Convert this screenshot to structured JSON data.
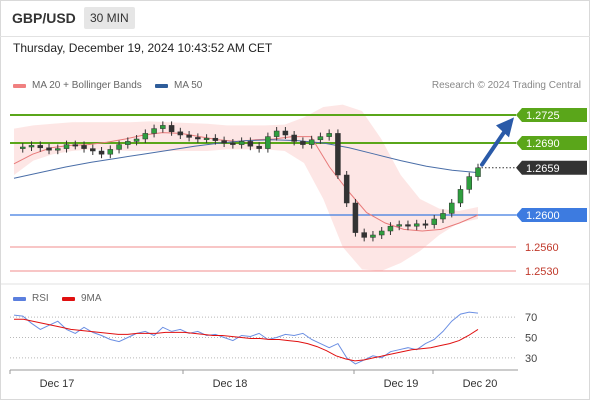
{
  "header": {
    "symbol": "GBP/USD",
    "timeframe": "30 MIN"
  },
  "timestamp": "Thursday, December 19, 2024 10:43:52 AM CET",
  "legend": {
    "main": [
      {
        "label": "MA 20 + Bollinger Bands",
        "color": "#f08080"
      },
      {
        "label": "MA 50",
        "color": "#2f5d9a"
      }
    ],
    "indicator": [
      {
        "label": "RSI",
        "color": "#5b7fde"
      },
      {
        "label": "9MA",
        "color": "#e01010"
      }
    ]
  },
  "credit": "Research © 2024 Trading Central",
  "chart_data": [
    {
      "type": "candlestick",
      "ylim": [
        1.2515,
        1.275
      ],
      "x_labels": [
        "Dec 17",
        "Dec 18",
        "Dec 19",
        "Dec 20"
      ],
      "levels": [
        {
          "value": 1.2725,
          "label": "1.2725",
          "kind": "resistance",
          "color": "#5aa61a"
        },
        {
          "value": 1.269,
          "label": "1.2690",
          "kind": "resistance",
          "color": "#5aa61a"
        },
        {
          "value": 1.2659,
          "label": "1.2659",
          "kind": "current",
          "color": "#333333"
        },
        {
          "value": 1.26,
          "label": "1.2600",
          "kind": "support",
          "color": "#3d7be0"
        },
        {
          "value": 1.256,
          "label": "1.2560",
          "kind": "support",
          "color": "#f28e8e"
        },
        {
          "value": 1.253,
          "label": "1.2530",
          "kind": "support",
          "color": "#f28e8e"
        }
      ],
      "close_path": [
        1.2683,
        1.2685,
        1.2687,
        1.2684,
        1.2681,
        1.2683,
        1.2688,
        1.2687,
        1.2683,
        1.268,
        1.2676,
        1.2682,
        1.2688,
        1.2692,
        1.2695,
        1.2702,
        1.2708,
        1.2712,
        1.2704,
        1.27,
        1.2697,
        1.2695,
        1.2696,
        1.2693,
        1.269,
        1.2688,
        1.2692,
        1.2686,
        1.2683,
        1.2698,
        1.2705,
        1.27,
        1.2692,
        1.2688,
        1.2694,
        1.2698,
        1.2702,
        1.265,
        1.2615,
        1.2578,
        1.2572,
        1.2575,
        1.258,
        1.2586,
        1.2588,
        1.2586,
        1.2589,
        1.2588,
        1.2595,
        1.2602,
        1.2615,
        1.2632,
        1.2648,
        1.2659
      ],
      "forecast": {
        "from": 1.2663,
        "to": 1.2722
      },
      "ma50": [
        1.2646,
        1.2653,
        1.266,
        1.2666,
        1.2671,
        1.2676,
        1.2681,
        1.2686,
        1.269,
        1.2693,
        1.2694,
        1.2693,
        1.269,
        1.2684,
        1.2676,
        1.2668,
        1.2661,
        1.2656,
        1.2653
      ],
      "ma20": [
        1.2664,
        1.2676,
        1.2684,
        1.2687,
        1.2688,
        1.2691,
        1.2695,
        1.27,
        1.2703,
        1.2702,
        1.2698,
        1.2694,
        1.2692,
        1.2694,
        1.2695,
        1.2698,
        1.2698,
        1.266,
        1.263,
        1.2603,
        1.259,
        1.2582,
        1.258,
        1.2582,
        1.259,
        1.26
      ]
    },
    {
      "type": "line",
      "ylim": [
        20,
        80
      ],
      "ticks": [
        70,
        50,
        30
      ],
      "series": [
        {
          "name": "RSI",
          "values": [
            72,
            71,
            64,
            58,
            62,
            66,
            58,
            54,
            60,
            55,
            52,
            48,
            46,
            50,
            54,
            56,
            52,
            60,
            56,
            58,
            54,
            56,
            52,
            53,
            50,
            47,
            52,
            51,
            54,
            48,
            50,
            53,
            52,
            54,
            48,
            44,
            40,
            44,
            30,
            24,
            28,
            32,
            30,
            36,
            38,
            40,
            38,
            44,
            48,
            56,
            66,
            73,
            75,
            74
          ]
        },
        {
          "name": "9MA",
          "values": [
            68,
            68,
            66,
            64,
            62,
            60,
            58,
            57,
            56,
            55,
            54,
            53,
            53,
            54,
            54,
            54,
            55,
            55,
            55,
            54,
            53,
            52,
            52,
            51,
            50,
            49,
            49,
            48,
            48,
            47,
            46,
            44,
            41,
            37,
            32,
            29,
            27,
            28,
            30,
            32,
            34,
            36,
            38,
            39,
            40,
            42,
            44,
            47,
            52,
            58
          ]
        }
      ]
    }
  ]
}
